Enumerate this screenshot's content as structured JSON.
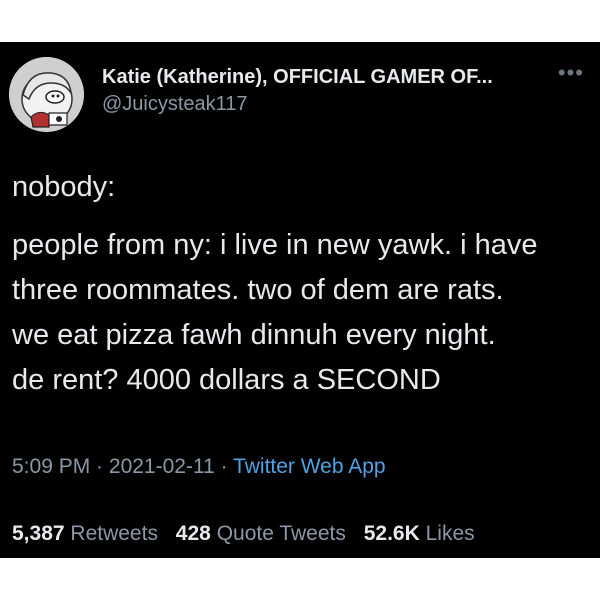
{
  "user": {
    "display_name": "Katie (Katherine), OFFICIAL GAMER OF...",
    "handle": "@Juicysteak117",
    "avatar_icon": "cartoon-avatar-icon"
  },
  "more_icon": "more-dots-icon",
  "tweet": {
    "line1": "nobody:",
    "line2": "people from ny: i live in new yawk. i have",
    "line3": "three roommates. two of dem are rats.",
    "line4": "we eat pizza fawh dinnuh every night.",
    "line5": "de rent? 4000 dollars a SECOND"
  },
  "meta": {
    "time": "5:09 PM",
    "separator1": " · ",
    "date": "2021-02-11",
    "separator2": " · ",
    "source": "Twitter Web App"
  },
  "stats": {
    "retweets_count": "5,387",
    "retweets_label": "Retweets",
    "quotes_count": "428",
    "quotes_label": "Quote Tweets",
    "likes_count": "52.6K",
    "likes_label": "Likes"
  },
  "colors": {
    "background": "#000000",
    "text": "#e7e9ea",
    "secondary": "#8b98a5",
    "link": "#4fa3e3"
  }
}
